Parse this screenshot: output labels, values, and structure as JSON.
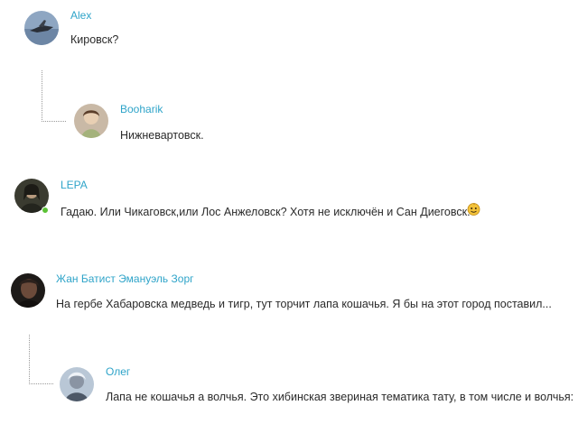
{
  "comments": [
    {
      "author": "Alex",
      "text": "Кировск?"
    },
    {
      "author": "Booharik",
      "text": "Нижневартовск."
    },
    {
      "author": "LEPA",
      "text": "Гадаю. Или Чикаговск,или Лос Анжеловск? Хотя не исключён и Сан Диеговск."
    },
    {
      "author": "Жан Батист Эмануэль Зорг",
      "text": "На гербе Хабаровска медведь и тигр, тут торчит лапа кошачья. Я бы на этот город поставил..."
    },
    {
      "author": "Олег",
      "text": "Лапа не кошачья а волчья. Это хибинская звериная тематика тату, в том числе и волчья:"
    }
  ],
  "colors": {
    "author_link": "#2fa4c9",
    "online": "#5bc236"
  },
  "icons": {
    "smiley": "smiley-icon"
  }
}
